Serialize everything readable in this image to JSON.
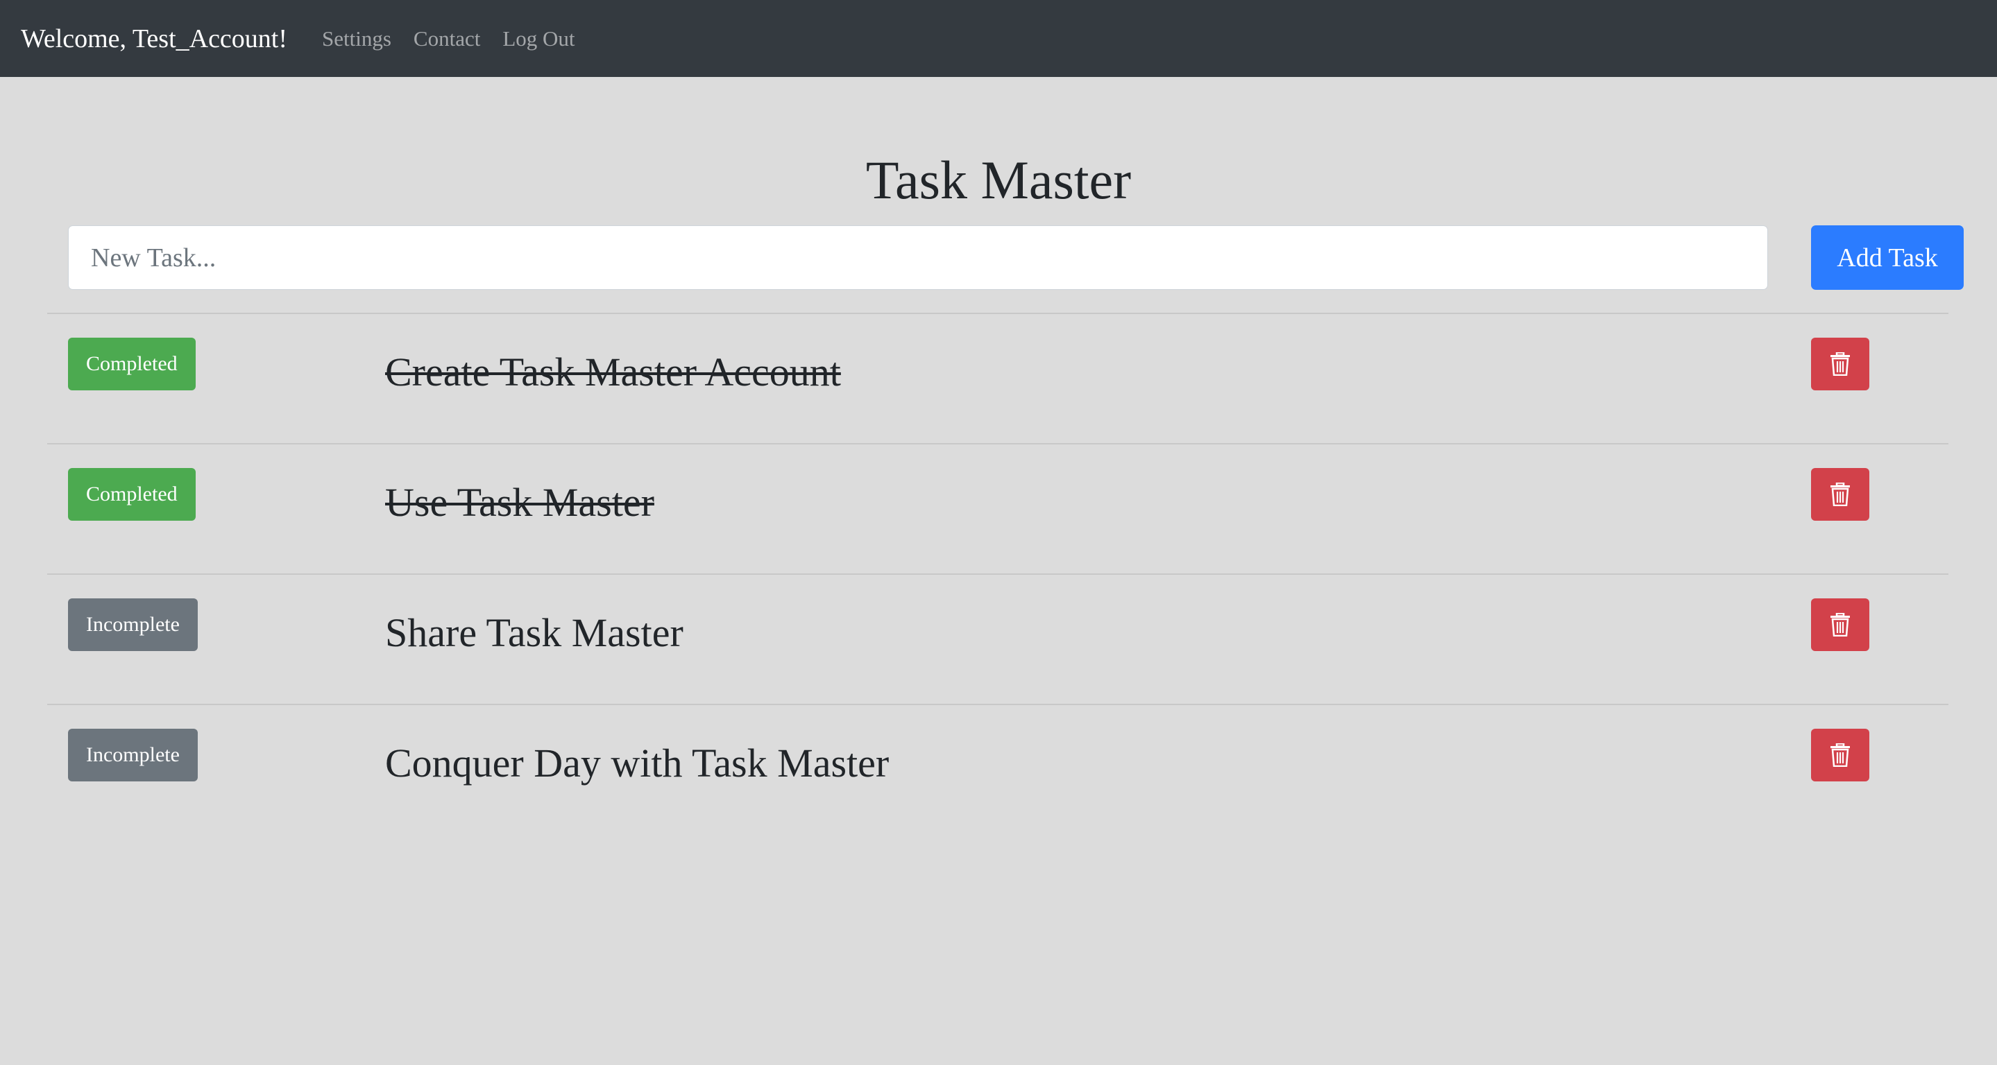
{
  "navbar": {
    "brand": "Welcome, Test_Account!",
    "links": [
      {
        "label": "Settings"
      },
      {
        "label": "Contact"
      },
      {
        "label": "Log Out"
      }
    ]
  },
  "main": {
    "title": "Task Master",
    "new_task": {
      "placeholder": "New Task...",
      "value": ""
    },
    "add_button_label": "Add Task",
    "delete_icon": "trash-icon",
    "tasks": [
      {
        "status": "Completed",
        "text": "Create Task Master Account",
        "done": true
      },
      {
        "status": "Completed",
        "text": "Use Task Master",
        "done": true
      },
      {
        "status": "Incomplete",
        "text": "Share Task Master",
        "done": false
      },
      {
        "status": "Incomplete",
        "text": "Conquer Day with Task Master",
        "done": false
      }
    ]
  },
  "colors": {
    "navbar_bg": "#343a40",
    "page_bg": "#dcdcdc",
    "primary": "#2b7cff",
    "completed": "#4caa50",
    "incomplete": "#6c757d",
    "danger": "#d2414a"
  }
}
